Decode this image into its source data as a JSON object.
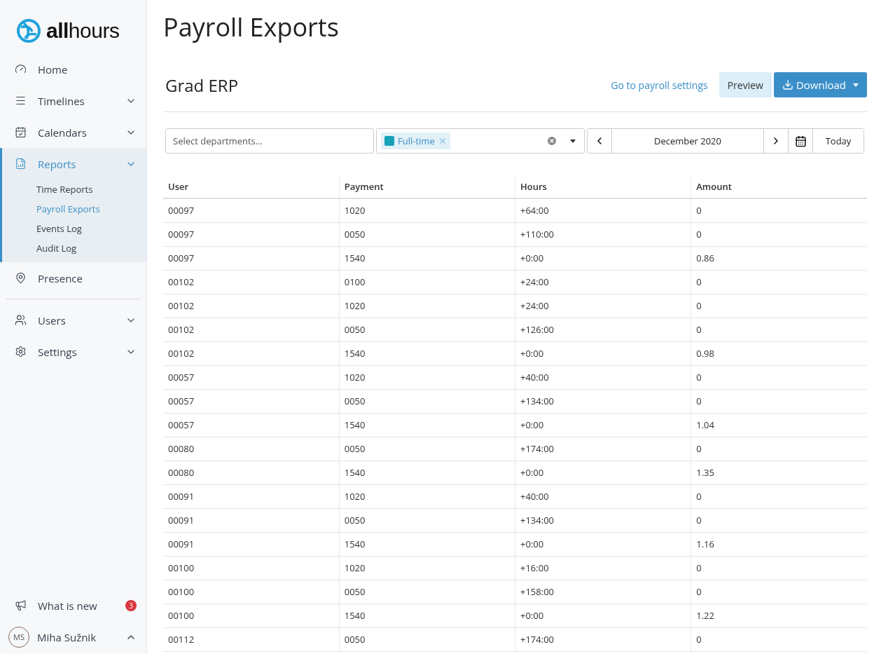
{
  "logo": {
    "text": "**all**hours"
  },
  "sidebar": {
    "items": [
      {
        "label": "Home",
        "kind": "link",
        "selected": false
      },
      {
        "label": "Timelines",
        "kind": "group",
        "selected": false,
        "expanded": false
      },
      {
        "label": "Calendars",
        "kind": "group",
        "selected": false,
        "expanded": false
      },
      {
        "label": "Reports",
        "kind": "group",
        "selected": true,
        "expanded": true,
        "children": [
          {
            "label": "Time Reports",
            "selected": false
          },
          {
            "label": "Payroll Exports",
            "selected": true
          },
          {
            "label": "Events Log",
            "selected": false
          },
          {
            "label": "Audit Log",
            "selected": false
          }
        ]
      },
      {
        "label": "Presence",
        "kind": "link",
        "selected": false
      },
      {
        "label": "Users",
        "kind": "group",
        "selected": false,
        "expanded": false
      },
      {
        "label": "Settings",
        "kind": "group",
        "selected": false,
        "expanded": false
      }
    ],
    "whats_new": {
      "label": "What is new",
      "count": "3"
    },
    "user": {
      "initials": "MS",
      "name": "Miha Sužnik",
      "expanded": true
    }
  },
  "page": {
    "title": "Payroll Exports",
    "subtitle": "Grad ERP",
    "settings_link": "Go to payroll settings",
    "preview_button": "Preview",
    "download_button": "Download"
  },
  "filters": {
    "departments": {
      "placeholder": "Select departments..."
    },
    "tags": [
      {
        "label": "Full-time",
        "color": "#17a2b8"
      }
    ],
    "month": "December 2020",
    "today": "Today"
  },
  "table": {
    "columns": [
      "User",
      "Payment",
      "Hours",
      "Amount"
    ],
    "rows": [
      [
        "00097",
        "1020",
        "+64:00",
        "0"
      ],
      [
        "00097",
        "0050",
        "+110:00",
        "0"
      ],
      [
        "00097",
        "1540",
        "+0:00",
        "0.86"
      ],
      [
        "00102",
        "0100",
        "+24:00",
        "0"
      ],
      [
        "00102",
        "1020",
        "+24:00",
        "0"
      ],
      [
        "00102",
        "0050",
        "+126:00",
        "0"
      ],
      [
        "00102",
        "1540",
        "+0:00",
        "0.98"
      ],
      [
        "00057",
        "1020",
        "+40:00",
        "0"
      ],
      [
        "00057",
        "0050",
        "+134:00",
        "0"
      ],
      [
        "00057",
        "1540",
        "+0:00",
        "1.04"
      ],
      [
        "00080",
        "0050",
        "+174:00",
        "0"
      ],
      [
        "00080",
        "1540",
        "+0:00",
        "1.35"
      ],
      [
        "00091",
        "1020",
        "+40:00",
        "0"
      ],
      [
        "00091",
        "0050",
        "+134:00",
        "0"
      ],
      [
        "00091",
        "1540",
        "+0:00",
        "1.16"
      ],
      [
        "00100",
        "1020",
        "+16:00",
        "0"
      ],
      [
        "00100",
        "0050",
        "+158:00",
        "0"
      ],
      [
        "00100",
        "1540",
        "+0:00",
        "1.22"
      ],
      [
        "00112",
        "0050",
        "+174:00",
        "0"
      ]
    ]
  }
}
